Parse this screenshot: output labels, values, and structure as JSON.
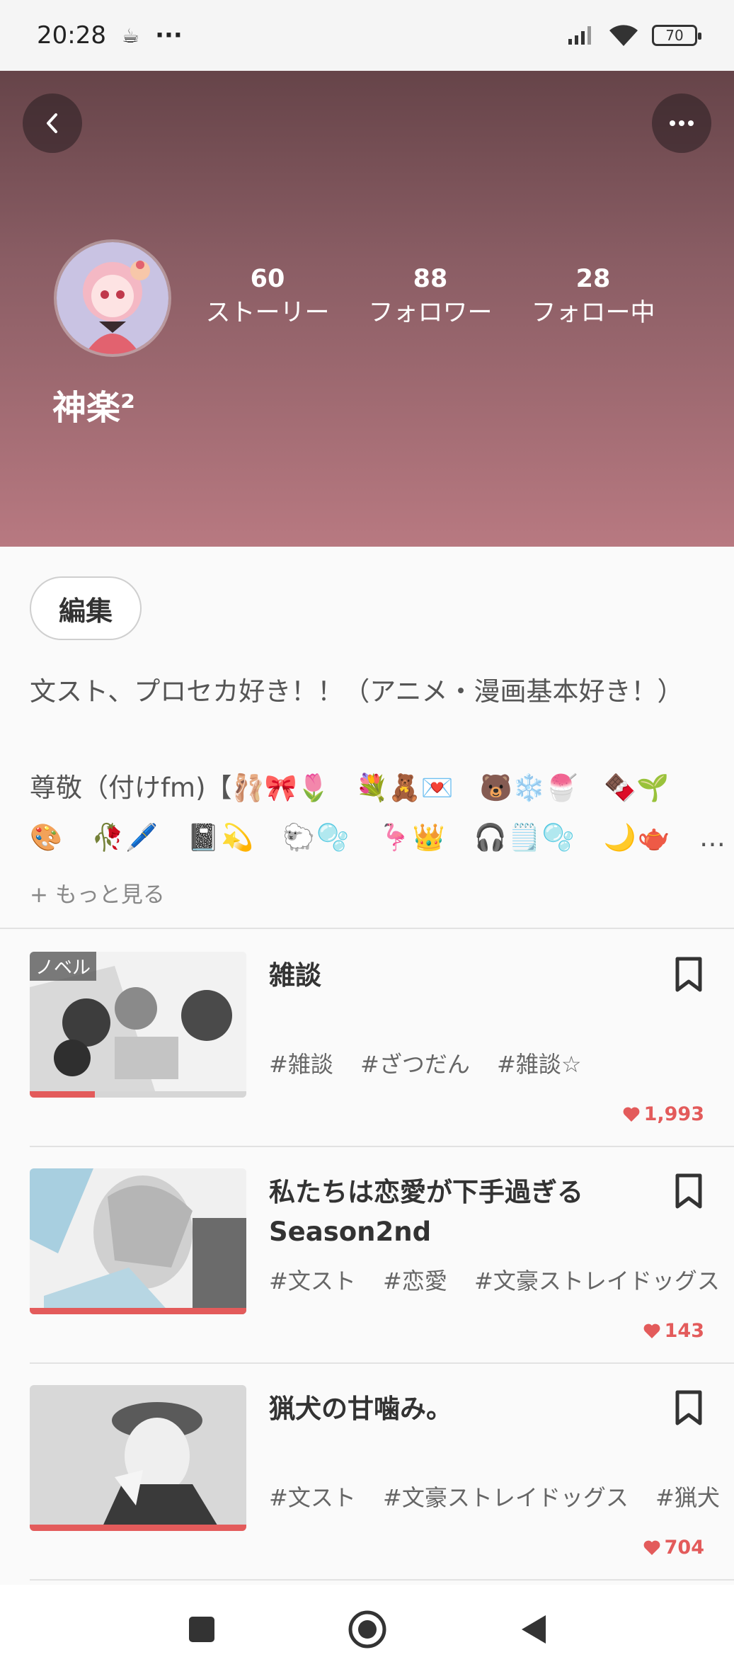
{
  "status_bar": {
    "time": "20:28",
    "cup_icon": "☕",
    "dots": "···",
    "battery": "70"
  },
  "header": {
    "back_icon": "chevron-left-icon",
    "more_icon": "more-horizontal-icon",
    "username": "神楽²",
    "stats": [
      {
        "value": "60",
        "label": "ストーリー"
      },
      {
        "value": "88",
        "label": "フォロワー"
      },
      {
        "value": "28",
        "label": "フォロー中"
      }
    ],
    "colors": {
      "top": "#664449",
      "bottom": "#b87981"
    }
  },
  "profile": {
    "edit_label": "編集",
    "bio_line1": "文スト、プロセカ好き！！（アニメ・漫画基本好き！）",
    "bio_line2": "尊敬（付けfm)【🩰🎀🌷　💐🧸💌　🐻❄️🍧　🍫🌱",
    "bio_line3": "🎨　🥀🖊️　📓💫　🐑🫧　🦩👑　🎧🗒️🫧　🌙🫖　…",
    "more_label": "+ もっと見る"
  },
  "stories": [
    {
      "badge": "ノベル",
      "title": "雑談",
      "tags": [
        "#雑談",
        "#ざつだん",
        "#雑談☆"
      ],
      "likes": "1,993",
      "progress": 0.3
    },
    {
      "badge": "",
      "title": "私たちは恋愛が下手過ぎる Season2nd",
      "tags": [
        "#文スト",
        "#恋愛",
        "#文豪ストレイドッグス"
      ],
      "likes": "143",
      "progress": 1.0
    },
    {
      "badge": "",
      "title": "猟犬の甘噛み。",
      "tags": [
        "#文スト",
        "#文豪ストレイドッグス",
        "#猟犬"
      ],
      "likes": "704",
      "progress": 1.0
    }
  ],
  "accent_color": "#e35b5b"
}
